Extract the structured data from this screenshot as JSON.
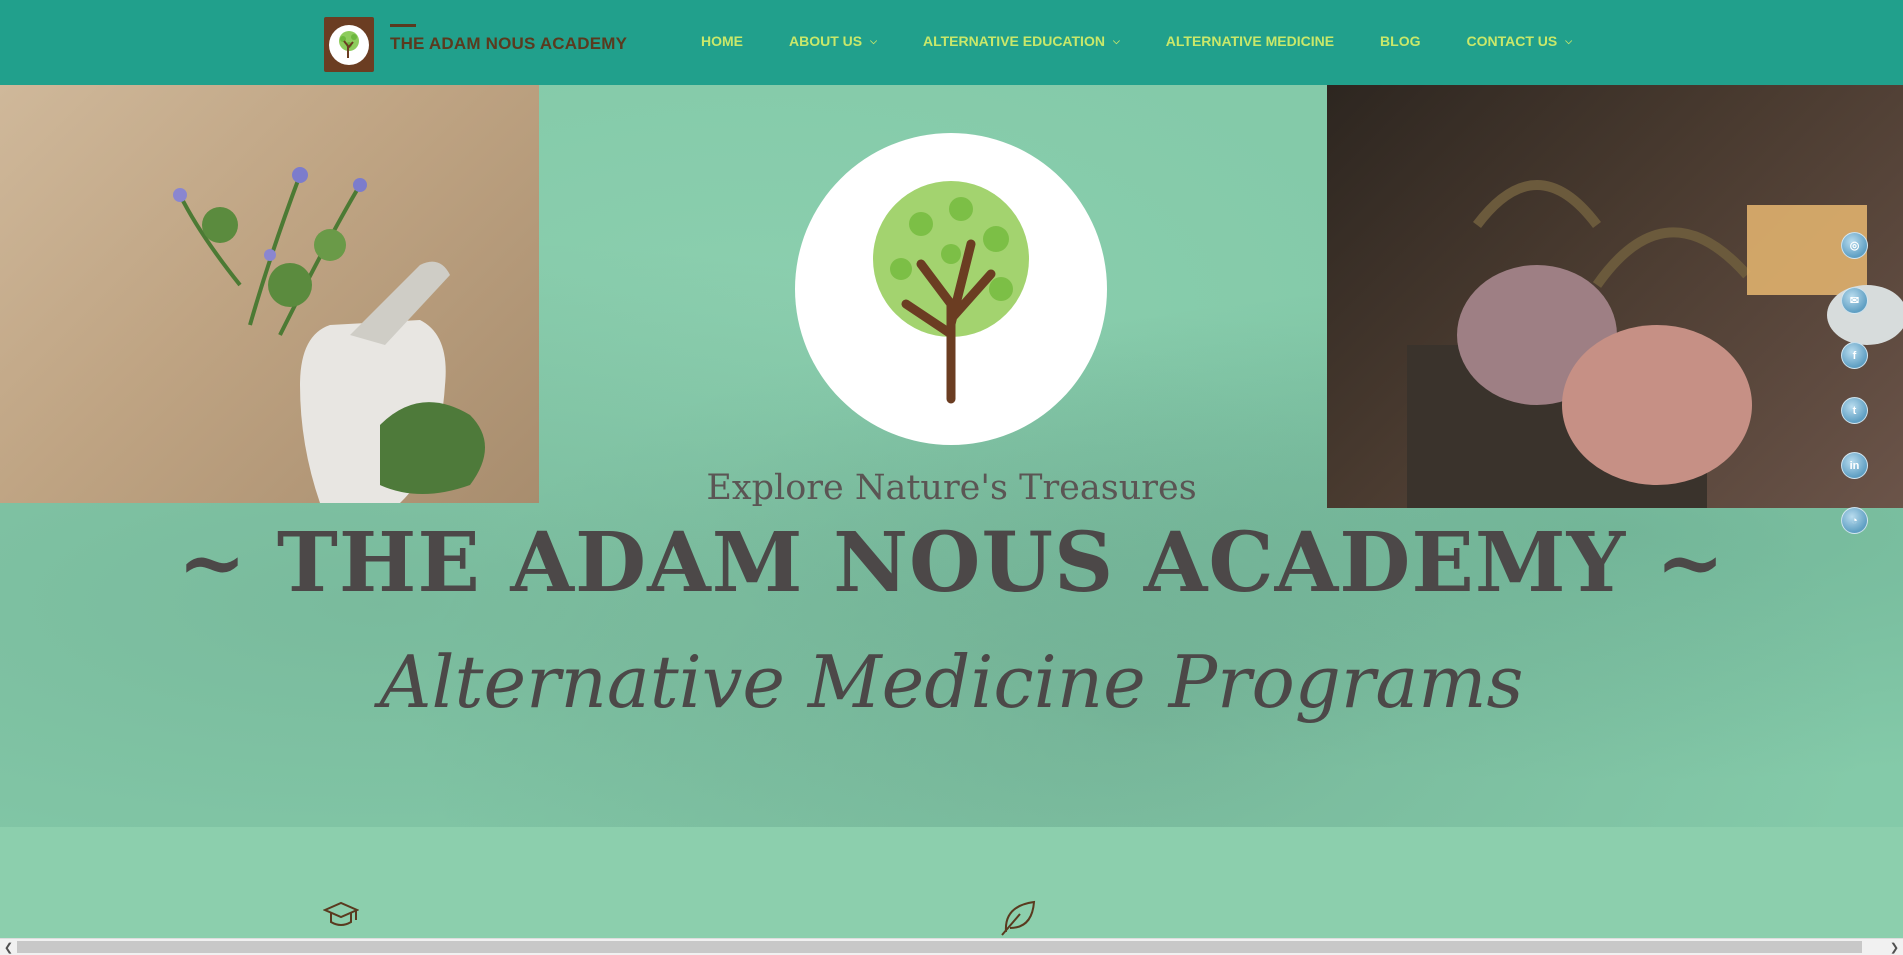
{
  "header": {
    "site_title": "THE ADAM NOUS ACADEMY",
    "logo_icon": "tree-logo-icon"
  },
  "nav": [
    {
      "label": "HOME",
      "has_dropdown": false
    },
    {
      "label": "ABOUT US",
      "has_dropdown": true
    },
    {
      "label": "ALTERNATIVE EDUCATION",
      "has_dropdown": true
    },
    {
      "label": "ALTERNATIVE MEDICINE",
      "has_dropdown": false
    },
    {
      "label": "BLOG",
      "has_dropdown": false
    },
    {
      "label": "CONTACT US",
      "has_dropdown": true
    }
  ],
  "hero": {
    "tagline": "Explore Nature's Treasures",
    "title": "~ THE ADAM NOUS ACADEMY ~",
    "subtitle": "Alternative Medicine Programs"
  },
  "social": [
    {
      "icon": "instagram-icon",
      "glyph": "◎"
    },
    {
      "icon": "email-icon",
      "glyph": "✉"
    },
    {
      "icon": "facebook-icon",
      "glyph": "f"
    },
    {
      "icon": "twitter-icon",
      "glyph": "t"
    },
    {
      "icon": "linkedin-icon",
      "glyph": "in"
    },
    {
      "icon": "rss-icon",
      "glyph": "◔"
    }
  ],
  "features": [
    {
      "icon": "graduation-cap-icon"
    },
    {
      "icon": "leaf-icon"
    }
  ],
  "colors": {
    "header_bg": "#21a08c",
    "nav_text": "#c9e86a",
    "title_brown": "#5a3a1f",
    "hero_bg": "#84caa9",
    "page_bg": "#8ccfad"
  }
}
